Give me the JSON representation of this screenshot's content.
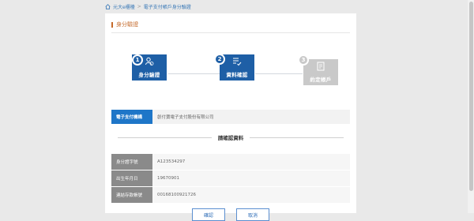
{
  "breadcrumb": {
    "home": "元大e櫃檯",
    "current": "電子支付帳戶身分驗證"
  },
  "section_title": "身分驗證",
  "steps": [
    {
      "number": "1",
      "label": "身分驗證",
      "state": "active",
      "icon": "user-check-icon"
    },
    {
      "number": "2",
      "label": "資料確認",
      "state": "active",
      "icon": "list-check-icon"
    },
    {
      "number": "3",
      "label": "約定帳戶",
      "state": "inactive",
      "icon": "document-icon"
    }
  ],
  "merchant": {
    "label": "電子支付機構",
    "value": "創付寶電子支付股份有限公司"
  },
  "confirm_title": "請確認資料",
  "info_rows": [
    {
      "label": "身分證字號",
      "value": "A123534297"
    },
    {
      "label": "出生年月日",
      "value": "19670901"
    },
    {
      "label": "連結存款帳號",
      "value": "00168100921726"
    }
  ],
  "buttons": {
    "confirm": "確認",
    "cancel": "取消"
  },
  "colors": {
    "active": "#1e5fa6",
    "inactive": "#c9c9c9",
    "accent": "#c56a2b"
  }
}
